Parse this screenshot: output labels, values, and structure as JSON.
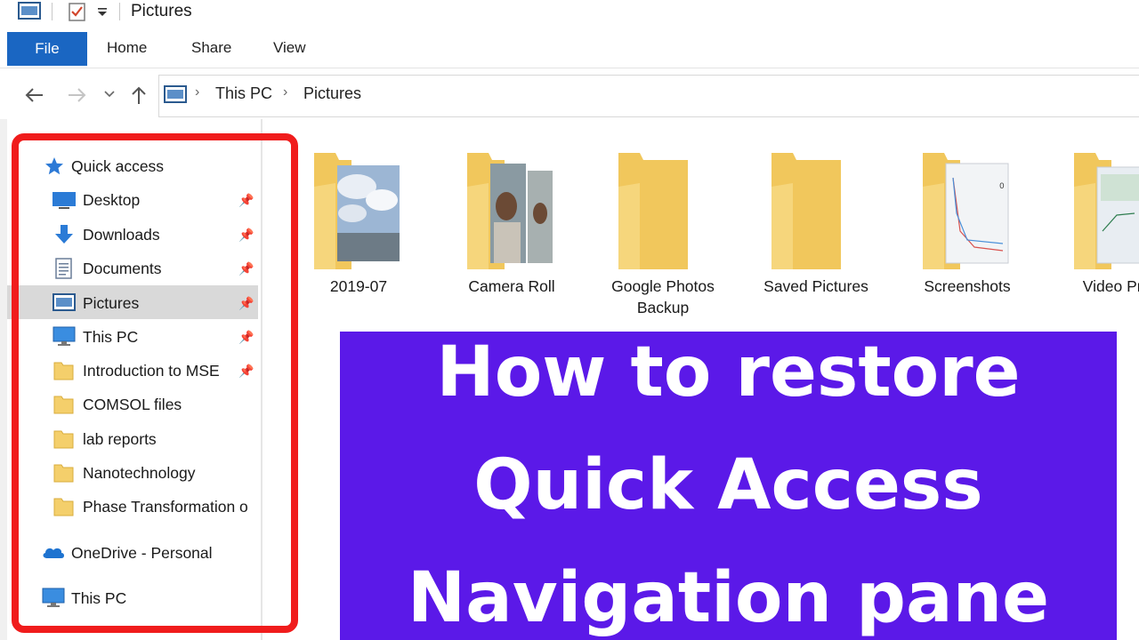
{
  "window": {
    "title": "Pictures"
  },
  "ribbon": {
    "tabs": [
      "File",
      "Home",
      "Share",
      "View"
    ]
  },
  "address_bar": {
    "breadcrumb": [
      "This PC",
      "Pictures"
    ]
  },
  "nav_pane": {
    "quick_access": "Quick access",
    "items": [
      {
        "label": "Desktop",
        "icon": "desktop-icon",
        "pinned": true
      },
      {
        "label": "Downloads",
        "icon": "download-arrow-icon",
        "pinned": true
      },
      {
        "label": "Documents",
        "icon": "document-icon",
        "pinned": true
      },
      {
        "label": "Pictures",
        "icon": "pictures-icon",
        "pinned": true,
        "selected": true
      },
      {
        "label": "This PC",
        "icon": "computer-icon",
        "pinned": true
      },
      {
        "label": "Introduction to MSE",
        "icon": "folder-icon",
        "pinned": true
      },
      {
        "label": "COMSOL files",
        "icon": "folder-icon",
        "pinned": false
      },
      {
        "label": "lab reports",
        "icon": "folder-icon",
        "pinned": false
      },
      {
        "label": "Nanotechnology",
        "icon": "folder-icon",
        "pinned": false
      },
      {
        "label": "Phase Transformation o",
        "icon": "folder-icon",
        "pinned": false
      }
    ],
    "onedrive": "OneDrive - Personal",
    "this_pc": "This PC"
  },
  "folders": [
    {
      "label": "2019-07"
    },
    {
      "label": "Camera Roll"
    },
    {
      "label": "Google Photos Backup"
    },
    {
      "label": "Saved Pictures"
    },
    {
      "label": "Screenshots"
    },
    {
      "label": "Video Proj"
    }
  ],
  "banner": {
    "lines": [
      "How to restore",
      "Quick Access",
      "Navigation pane"
    ],
    "background": "#5b19e8",
    "text_color": "#ffffff"
  },
  "colors": {
    "file_tab": "#1a66c2",
    "highlight": "#f01c1c",
    "folder": "#f4cf6b",
    "selection": "#d9d9d9"
  }
}
